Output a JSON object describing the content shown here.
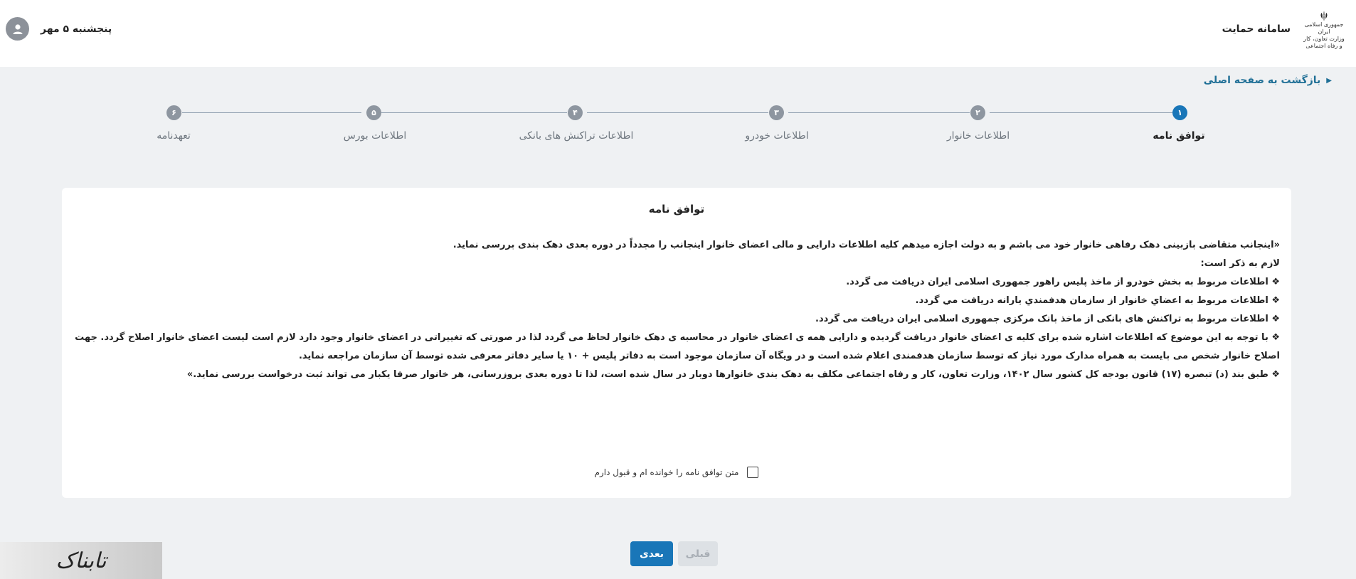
{
  "header": {
    "app_title": "سامانه حمایت",
    "ministry_line1": "جمهوری اسلامی ایران",
    "ministry_line2": "وزارت تعاون، کار و رفاه اجتماعی",
    "date": "پنجشنبه ۵ مهر",
    "avatar_icon": "user-icon",
    "emblem_icon": "iran-emblem-icon"
  },
  "back_link": {
    "label": "بازگشت به صفحه اصلی",
    "icon": "chevron-right-icon"
  },
  "stepper": {
    "steps": [
      {
        "number": "۱",
        "label": "توافق نامه",
        "active": true
      },
      {
        "number": "۲",
        "label": "اطلاعات خانوار",
        "active": false
      },
      {
        "number": "۳",
        "label": "اطلاعات خودرو",
        "active": false
      },
      {
        "number": "۴",
        "label": "اطلاعات تراکنش های بانکی",
        "active": false
      },
      {
        "number": "۵",
        "label": "اطلاعات بورس",
        "active": false
      },
      {
        "number": "۶",
        "label": "تعهدنامه",
        "active": false
      }
    ],
    "active_color": "#1976b8",
    "inactive_color": "#8e96a0"
  },
  "card": {
    "title": "توافق نامه",
    "paragraphs": [
      "«اینجانب متقاضی بازبینی دهک رفاهی خانوار خود می باشم و به دولت اجازه میدهم کلیه اطلاعات دارایی و مالی اعضای خانوار اینجانب را مجدداً در دوره بعدی دهک بندی بررسی نماید.",
      "لازم به ذکر است:",
      "❖ اطلاعات مربوط به بخش خودرو از ماخذ پلیس راهور جمهوری اسلامی ایران دریافت می گردد.",
      "❖ اطلاعات مربوط به اعضاي خانوار از سازمان هدفمندي يارانه دريافت مي گردد.",
      "❖ اطلاعات مربوط به تراکنش های بانکی از ماخذ بانک مرکزی جمهوری اسلامی ایران دریافت می گردد.",
      "❖ با توجه به این موضوع که اطلاعات اشاره شده برای کلیه ی اعضای خانوار دریافت گردیده و دارایی همه ی اعضای خانوار در محاسبه ی دهک خانوار لحاظ می گردد لذا در صورتی که تغییراتی در اعضای خانوار وجود دارد لازم است لیست اعضای خانوار اصلاح گردد. جهت اصلاح خانوار شخص می بایست به همراه مدارک مورد نیاز که توسط سازمان هدفمندی اعلام شده است و در ویگاه آن سازمان موجود است به دفاتر پلیس + ۱۰ یا سایر دفاتر معرفی شده توسط آن سازمان مراجعه نماید.",
      "❖ طبق بند (د) تبصره (۱۷) قانون بودجه کل کشور سال ۱۴۰۲، وزارت تعاون، کار و رفاه اجتماعی مکلف به دهک بندی خانوارها دوبار در سال شده است، لذا تا دوره بعدی بروزرسانی، هر خانوار صرفا یکبار می تواند ثبت درخواست بررسی نماید.»"
    ],
    "consent_label": "متن توافق نامه را خوانده ام و قبول دارم",
    "consent_checked": false
  },
  "buttons": {
    "next_label": "بعدی",
    "prev_label": "قبلی",
    "next_color": "#1976b8"
  },
  "watermark": {
    "text": "تابناک"
  }
}
